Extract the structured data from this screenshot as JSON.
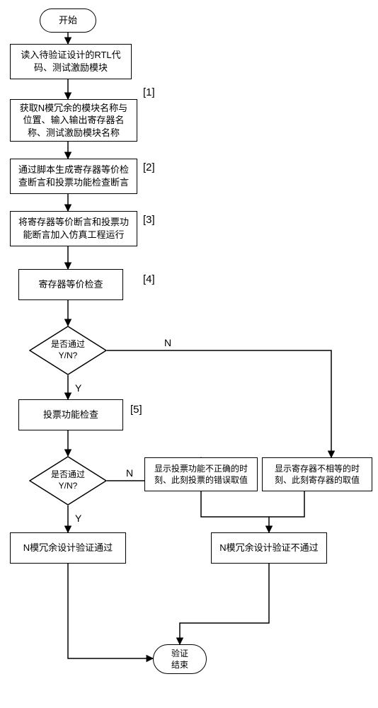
{
  "chart_data": {
    "type": "flowchart",
    "title": "",
    "nodes": [
      {
        "id": "start",
        "type": "terminator",
        "text": "开始"
      },
      {
        "id": "s1",
        "type": "process",
        "text": "读入待验证设计的RTL代码、测试激励模块"
      },
      {
        "id": "s2",
        "type": "process",
        "text": "获取N模冗余的模块名称与位置、输入输出寄存器名称、测试激励模块名称",
        "tag": "[1]"
      },
      {
        "id": "s3",
        "type": "process",
        "text": "通过脚本生成寄存器等价检查断言和投票功能检查断言",
        "tag": "[2]"
      },
      {
        "id": "s4",
        "type": "process",
        "text": "将寄存器等价断言和投票功能断言加入仿真工程运行",
        "tag": "[3]"
      },
      {
        "id": "s5",
        "type": "process",
        "text": "寄存器等价检查",
        "tag": "[4]"
      },
      {
        "id": "d1",
        "type": "decision",
        "text": "是否通过 Y/N?"
      },
      {
        "id": "s6",
        "type": "process",
        "text": "投票功能检查",
        "tag": "[5]"
      },
      {
        "id": "d2",
        "type": "decision",
        "text": "是否通过 Y/N?"
      },
      {
        "id": "pass",
        "type": "process",
        "text": "N模冗余设计验证通过"
      },
      {
        "id": "err_vote",
        "type": "process",
        "text": "显示投票功能不正确的时刻、此刻投票的错误取值"
      },
      {
        "id": "err_reg",
        "type": "process",
        "text": "显示寄存器不相等的时刻、此刻寄存器的取值"
      },
      {
        "id": "fail",
        "type": "process",
        "text": "N模冗余设计验证不通过"
      },
      {
        "id": "end",
        "type": "terminator",
        "text": "验证结束"
      }
    ],
    "edges": [
      {
        "from": "start",
        "to": "s1"
      },
      {
        "from": "s1",
        "to": "s2"
      },
      {
        "from": "s2",
        "to": "s3"
      },
      {
        "from": "s3",
        "to": "s4"
      },
      {
        "from": "s4",
        "to": "s5"
      },
      {
        "from": "s5",
        "to": "d1"
      },
      {
        "from": "d1",
        "to": "s6",
        "label": "Y"
      },
      {
        "from": "d1",
        "to": "err_reg",
        "label": "N"
      },
      {
        "from": "s6",
        "to": "d2"
      },
      {
        "from": "d2",
        "to": "pass",
        "label": "Y"
      },
      {
        "from": "d2",
        "to": "err_vote",
        "label": "N"
      },
      {
        "from": "err_vote",
        "to": "fail"
      },
      {
        "from": "err_reg",
        "to": "fail"
      },
      {
        "from": "pass",
        "to": "end"
      },
      {
        "from": "fail",
        "to": "end"
      }
    ]
  },
  "labels": {
    "start": "开始",
    "s1": "读入待验证设计的RTL代\n码、测试激励模块",
    "s2": "获取N模冗余的模块名称与\n位置、输入输出寄存器名\n称、测试激励模块名称",
    "s3": "通过脚本生成寄存器等价检\n查断言和投票功能检查断言",
    "s4": "将寄存器等价断言和投票功\n能断言加入仿真工程运行",
    "s5": "寄存器等价检查",
    "d1": "是否通过\nY/N?",
    "s6": "投票功能检查",
    "d2": "是否通过\nY/N?",
    "pass": "N模冗余设计验证通过",
    "err_vote": "显示投票功能不正确的时\n刻、此刻投票的错误取值",
    "err_reg": "显示寄存器不相等的时\n刻、此刻寄存器的取值",
    "fail": "N模冗余设计验证不通过",
    "end": "验证\n结束",
    "tag1": "[1]",
    "tag2": "[2]",
    "tag3": "[3]",
    "tag4": "[4]",
    "tag5": "[5]",
    "Y": "Y",
    "N": "N"
  }
}
